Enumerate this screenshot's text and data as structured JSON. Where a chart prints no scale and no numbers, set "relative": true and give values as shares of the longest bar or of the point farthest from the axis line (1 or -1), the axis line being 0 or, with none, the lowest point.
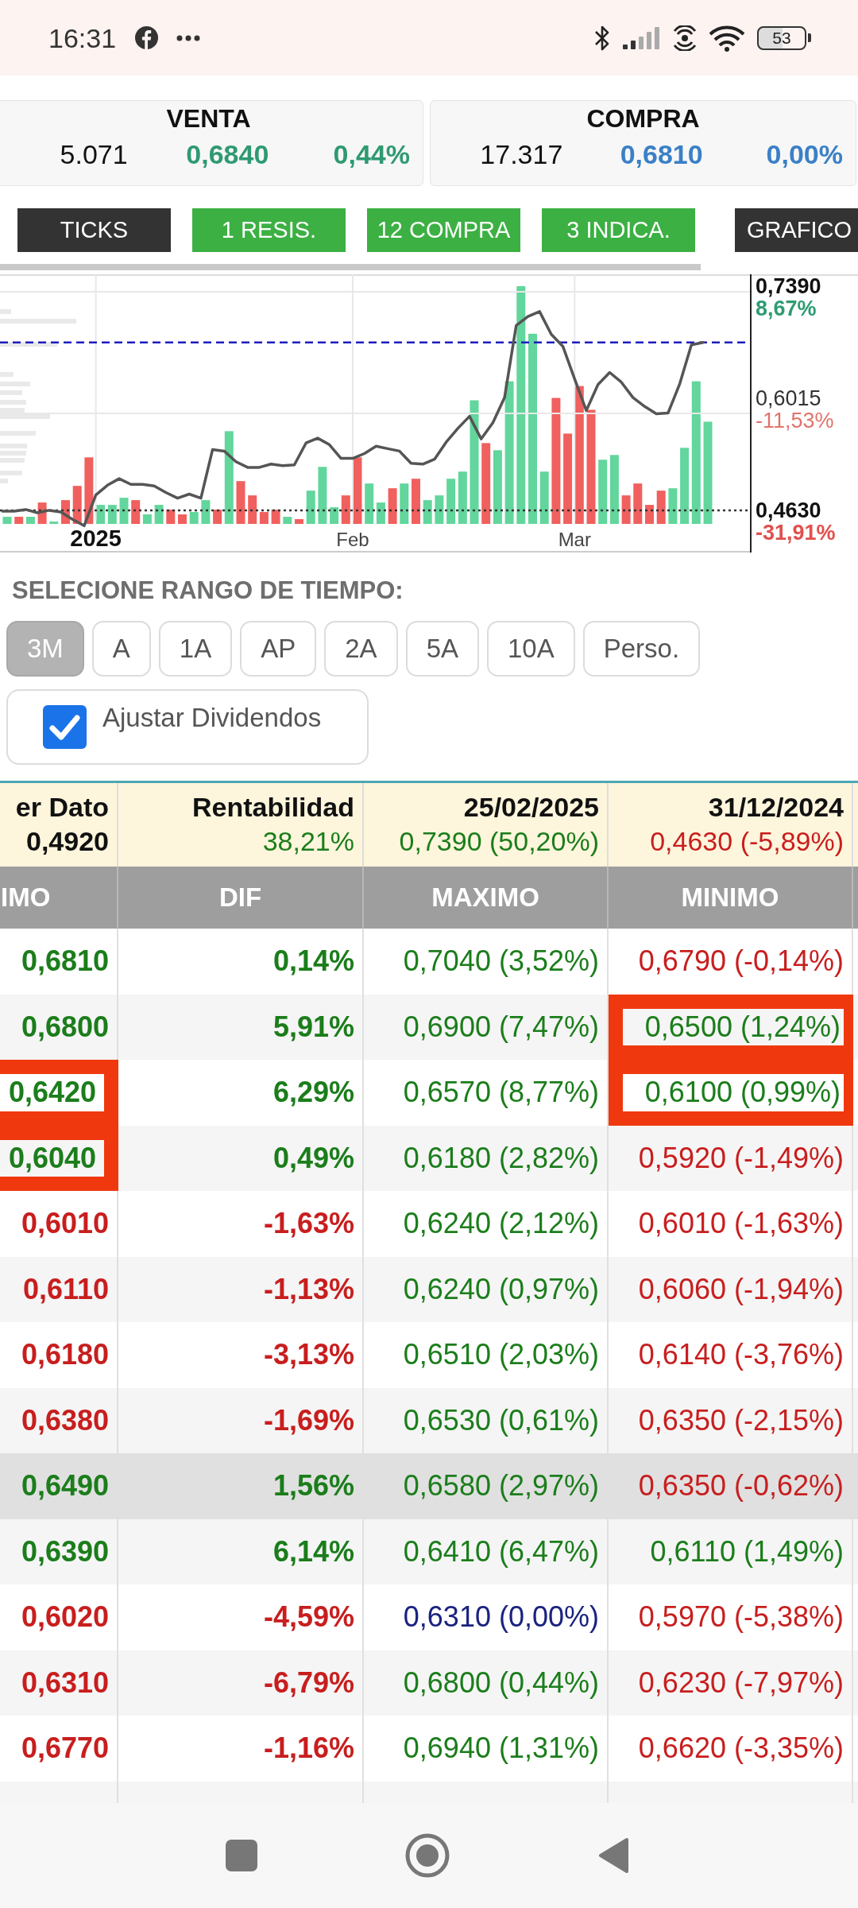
{
  "status_bar": {
    "time": "16:31",
    "battery": "53"
  },
  "quotes": [
    {
      "title": "VENTA",
      "cells": [
        {
          "text": "5.071",
          "kind": "plain"
        },
        {
          "text": "0,6840",
          "kind": "gain"
        },
        {
          "text": "0,44%",
          "kind": "gain"
        }
      ]
    },
    {
      "title": "COMPRA",
      "cells": [
        {
          "text": "17.317",
          "kind": "plain"
        },
        {
          "text": "0,6810",
          "kind": "flat"
        },
        {
          "text": "0,00%",
          "kind": "flat"
        }
      ]
    }
  ],
  "toolbar": [
    {
      "label": "TICKS",
      "color": "#333333"
    },
    {
      "label": "1 RESIS.",
      "color": "#3cb043"
    },
    {
      "label": "12 COMPRA",
      "color": "#3cb043"
    },
    {
      "label": "3 INDICA.",
      "color": "#3cb043"
    },
    {
      "label": "GRAFICO",
      "color": "#333333"
    }
  ],
  "chart": {
    "price_changes": [
      {
        "text": "8,67%",
        "kind": "high"
      },
      {
        "text": "-11,53%",
        "kind": "mid"
      },
      {
        "text": "-31,91%",
        "kind": "low"
      }
    ],
    "category_styles": [
      {
        "kind": "year"
      },
      {
        "kind": "month"
      },
      {
        "kind": "month"
      }
    ],
    "chart_data": {
      "type": "line",
      "categories": [
        null,
        null,
        null,
        null,
        null,
        null,
        null,
        null,
        "2025",
        null,
        null,
        null,
        null,
        null,
        null,
        null,
        null,
        null,
        null,
        null,
        null,
        null,
        null,
        null,
        null,
        null,
        null,
        null,
        null,
        null,
        "Feb",
        null,
        null,
        null,
        null,
        null,
        null,
        null,
        null,
        null,
        null,
        null,
        null,
        null,
        null,
        null,
        null,
        null,
        null,
        "Mar",
        null,
        null,
        null,
        null,
        null,
        null,
        null,
        null,
        null,
        null,
        null
      ],
      "ylim": [
        0.411,
        0.754
      ],
      "yticks": [
        {
          "value": 0.739,
          "label": "0,7390"
        },
        {
          "value": 0.6015,
          "label": "0,6015"
        },
        {
          "value": 0.463,
          "label": "0,4630"
        }
      ],
      "grid": true,
      "series": [
        {
          "color": "#555555",
          "values": [
            0.462,
            0.462,
            0.464,
            0.46,
            0.463,
            0.461,
            0.452,
            0.444,
            0.482,
            0.494,
            0.502,
            0.495,
            0.495,
            0.493,
            0.485,
            0.478,
            0.483,
            0.478,
            0.538,
            0.536,
            0.523,
            0.516,
            0.516,
            0.52,
            0.518,
            0.519,
            0.546,
            0.552,
            0.544,
            0.527,
            0.527,
            0.533,
            0.542,
            0.539,
            0.536,
            0.521,
            0.52,
            0.526,
            0.547,
            0.564,
            0.579,
            0.551,
            0.571,
            0.602,
            0.691,
            0.702,
            0.708,
            0.68,
            0.665,
            0.625,
            0.586,
            0.618,
            0.633,
            0.621,
            0.602,
            0.591,
            0.582,
            0.583,
            0.619,
            0.667,
            0.67
          ]
        }
      ],
      "ref_lines": [
        {
          "axis": "y",
          "value": 0.67,
          "color": "#1c1cc0"
        },
        {
          "axis": "y",
          "value": 0.463,
          "color": "#333333"
        }
      ]
    }
  },
  "volume": {
    "chart_data": {
      "type": "bar",
      "relative": true,
      "stacked": true,
      "series": [
        {
          "color": "#62d69c",
          "values": [
            0.03,
            null,
            0.03,
            null,
            0.01,
            null,
            null,
            null,
            0.08,
            0.08,
            0.11,
            null,
            0.04,
            0.08,
            null,
            null,
            0.05,
            0.1,
            null,
            0.39,
            null,
            null,
            null,
            null,
            0.03,
            null,
            0.14,
            0.24,
            0.07,
            null,
            null,
            0.17,
            0.09,
            null,
            0.17,
            null,
            0.1,
            0.12,
            0.19,
            0.22,
            0.52,
            null,
            0.31,
            0.6,
            1.0,
            0.8,
            0.22,
            null,
            null,
            null,
            null,
            0.27,
            0.29,
            null,
            null,
            null,
            null,
            0.15,
            0.32,
            0.6,
            0.43
          ]
        },
        {
          "color": "#f0605e",
          "values": [
            null,
            0.03,
            null,
            0.09,
            null,
            0.1,
            0.16,
            0.28,
            null,
            null,
            null,
            0.1,
            null,
            null,
            0.06,
            0.04,
            null,
            null,
            0.06,
            null,
            0.18,
            0.12,
            0.05,
            0.06,
            null,
            0.02,
            null,
            null,
            null,
            0.12,
            0.28,
            null,
            null,
            0.15,
            null,
            0.19,
            null,
            null,
            null,
            null,
            null,
            0.34,
            null,
            null,
            null,
            null,
            null,
            0.53,
            0.38,
            0.58,
            0.48,
            null,
            null,
            0.12,
            0.17,
            0.08,
            0.14,
            null,
            null,
            null,
            null
          ]
        }
      ]
    }
  },
  "time_range": {
    "title": "SELECIONE RANGO DE TIEMPO:",
    "options": [
      {
        "label": "3M",
        "selected": true
      },
      {
        "label": "A",
        "selected": false
      },
      {
        "label": "1A",
        "selected": false
      },
      {
        "label": "AP",
        "selected": false
      },
      {
        "label": "2A",
        "selected": false
      },
      {
        "label": "5A",
        "selected": false
      },
      {
        "label": "10A",
        "selected": false
      },
      {
        "label": "Perso.",
        "selected": false
      }
    ]
  },
  "adjust_dividends": {
    "label": "Ajustar Dividendos",
    "checked": true
  },
  "summary": {
    "columns": [
      {
        "header": "er Dato",
        "value": "0,4920",
        "kind": "plain"
      },
      {
        "header": "Rentabilidad",
        "value": "38,21%",
        "kind": "gain"
      },
      {
        "header": "25/02/2025",
        "value": "0,7390 (50,20%)",
        "kind": "gain"
      },
      {
        "header": "31/12/2024",
        "value": "0,4630 (-5,89%)",
        "kind": "loss"
      }
    ]
  },
  "table": {
    "columns": [
      "IMO",
      "DIF",
      "MAXIMO",
      "MINIMO"
    ],
    "rows": [
      {
        "selected": false,
        "cells": [
          {
            "text": "0,6810",
            "kind": "gain",
            "marked": false
          },
          {
            "text": "0,14%",
            "kind": "gain",
            "marked": false
          },
          {
            "text": "0,7040 (3,52%)",
            "kind": "gain",
            "marked": false
          },
          {
            "text": "0,6790 (-0,14%)",
            "kind": "loss",
            "marked": false
          }
        ]
      },
      {
        "selected": false,
        "cells": [
          {
            "text": "0,6800",
            "kind": "gain",
            "marked": false
          },
          {
            "text": "5,91%",
            "kind": "gain",
            "marked": false
          },
          {
            "text": "0,6900 (7,47%)",
            "kind": "gain",
            "marked": false
          },
          {
            "text": "0,6500 (1,24%)",
            "kind": "gain",
            "marked": true
          }
        ]
      },
      {
        "selected": false,
        "cells": [
          {
            "text": "0,6420",
            "kind": "gain",
            "marked": true
          },
          {
            "text": "6,29%",
            "kind": "gain",
            "marked": false
          },
          {
            "text": "0,6570 (8,77%)",
            "kind": "gain",
            "marked": false
          },
          {
            "text": "0,6100 (0,99%)",
            "kind": "gain",
            "marked": true
          }
        ]
      },
      {
        "selected": false,
        "cells": [
          {
            "text": "0,6040",
            "kind": "gain",
            "marked": true
          },
          {
            "text": "0,49%",
            "kind": "gain",
            "marked": false
          },
          {
            "text": "0,6180 (2,82%)",
            "kind": "gain",
            "marked": false
          },
          {
            "text": "0,5920 (-1,49%)",
            "kind": "loss",
            "marked": false
          }
        ]
      },
      {
        "selected": false,
        "cells": [
          {
            "text": "0,6010",
            "kind": "loss",
            "marked": false
          },
          {
            "text": "-1,63%",
            "kind": "loss",
            "marked": false
          },
          {
            "text": "0,6240 (2,12%)",
            "kind": "gain",
            "marked": false
          },
          {
            "text": "0,6010 (-1,63%)",
            "kind": "loss",
            "marked": false
          }
        ]
      },
      {
        "selected": false,
        "cells": [
          {
            "text": "0,6110",
            "kind": "loss",
            "marked": false
          },
          {
            "text": "-1,13%",
            "kind": "loss",
            "marked": false
          },
          {
            "text": "0,6240 (0,97%)",
            "kind": "gain",
            "marked": false
          },
          {
            "text": "0,6060 (-1,94%)",
            "kind": "loss",
            "marked": false
          }
        ]
      },
      {
        "selected": false,
        "cells": [
          {
            "text": "0,6180",
            "kind": "loss",
            "marked": false
          },
          {
            "text": "-3,13%",
            "kind": "loss",
            "marked": false
          },
          {
            "text": "0,6510 (2,03%)",
            "kind": "gain",
            "marked": false
          },
          {
            "text": "0,6140 (-3,76%)",
            "kind": "loss",
            "marked": false
          }
        ]
      },
      {
        "selected": false,
        "cells": [
          {
            "text": "0,6380",
            "kind": "loss",
            "marked": false
          },
          {
            "text": "-1,69%",
            "kind": "loss",
            "marked": false
          },
          {
            "text": "0,6530 (0,61%)",
            "kind": "gain",
            "marked": false
          },
          {
            "text": "0,6350 (-2,15%)",
            "kind": "loss",
            "marked": false
          }
        ]
      },
      {
        "selected": true,
        "cells": [
          {
            "text": "0,6490",
            "kind": "gain",
            "marked": false
          },
          {
            "text": "1,56%",
            "kind": "gain",
            "marked": false
          },
          {
            "text": "0,6580 (2,97%)",
            "kind": "gain",
            "marked": false
          },
          {
            "text": "0,6350 (-0,62%)",
            "kind": "loss",
            "marked": false
          }
        ]
      },
      {
        "selected": false,
        "cells": [
          {
            "text": "0,6390",
            "kind": "gain",
            "marked": false
          },
          {
            "text": "6,14%",
            "kind": "gain",
            "marked": false
          },
          {
            "text": "0,6410 (6,47%)",
            "kind": "gain",
            "marked": false
          },
          {
            "text": "0,6110 (1,49%)",
            "kind": "gain",
            "marked": false
          }
        ]
      },
      {
        "selected": false,
        "cells": [
          {
            "text": "0,6020",
            "kind": "loss",
            "marked": false
          },
          {
            "text": "-4,59%",
            "kind": "loss",
            "marked": false
          },
          {
            "text": "0,6310 (0,00%)",
            "kind": "flat",
            "marked": false
          },
          {
            "text": "0,5970 (-5,38%)",
            "kind": "loss",
            "marked": false
          }
        ]
      },
      {
        "selected": false,
        "cells": [
          {
            "text": "0,6310",
            "kind": "loss",
            "marked": false
          },
          {
            "text": "-6,79%",
            "kind": "loss",
            "marked": false
          },
          {
            "text": "0,6800 (0,44%)",
            "kind": "gain",
            "marked": false
          },
          {
            "text": "0,6230 (-7,97%)",
            "kind": "loss",
            "marked": false
          }
        ]
      },
      {
        "selected": false,
        "cells": [
          {
            "text": "0,6770",
            "kind": "loss",
            "marked": false
          },
          {
            "text": "-1,16%",
            "kind": "loss",
            "marked": false
          },
          {
            "text": "0,6940 (1,31%)",
            "kind": "gain",
            "marked": false
          },
          {
            "text": "0,6620 (-3,35%)",
            "kind": "loss",
            "marked": false
          }
        ]
      }
    ]
  }
}
